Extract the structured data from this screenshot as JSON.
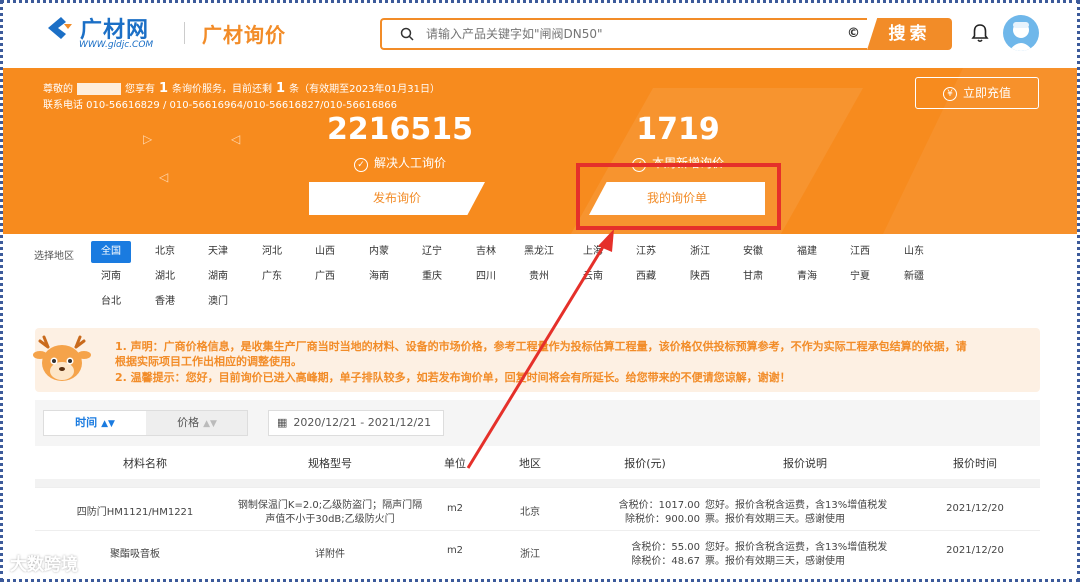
{
  "header": {
    "logo_text": "广材网",
    "logo_sub": "WWW.gldjc.COM",
    "brand_title": "广材询价",
    "search_placeholder": "请输入产品关键字如\"闸阀DN50\"",
    "clear_label": "©",
    "search_button": "搜索"
  },
  "banner": {
    "greet_prefix": "尊敬的",
    "greet_mid1": "您享有",
    "service_count": "1",
    "greet_mid2": "条询价服务，目前还剩",
    "remaining_count": "1",
    "greet_suffix": "条（有效期至2023年01月31日）",
    "phone_label": "联系电话 010-56616829 / 010-56616964/010-56616827/010-56616866",
    "recharge_icon": "¥",
    "recharge_label": "立即充值",
    "stat1_value": "2216515",
    "stat1_label": "解决人工询价",
    "stat2_value": "1719",
    "stat2_label": "本周新增询价",
    "publish_button": "发布询价",
    "my_list_button": "我的询价单"
  },
  "regions": {
    "label": "选择地区",
    "row1": [
      "全国",
      "北京",
      "天津",
      "河北",
      "山西",
      "内蒙",
      "辽宁",
      "吉林",
      "黑龙江",
      "上海",
      "江苏",
      "浙江",
      "安徽",
      "福建",
      "江西",
      "山东"
    ],
    "row2": [
      "河南",
      "湖北",
      "湖南",
      "广东",
      "广西",
      "海南",
      "重庆",
      "四川",
      "贵州",
      "云南",
      "西藏",
      "陕西",
      "甘肃",
      "青海",
      "宁夏",
      "新疆"
    ],
    "row3": [
      "台北",
      "香港",
      "澳门"
    ],
    "active": "全国"
  },
  "notice": {
    "line1": "1. 声明：广商价格信息，是收集生产厂商当时当地的材料、设备的市场价格，参考工程量作为投标估算工程量，该价格仅供投标预算参考，不作为实际工程承包结算的依据，请",
    "line2": "根据实际项目工作出相应的调整使用。",
    "line3": "2. 温馨提示：您好，目前询价已进入高峰期，单子排队较多，如若发布询价单，回复时间将会有所延长。给您带来的不便请您谅解，谢谢！"
  },
  "toolbar": {
    "sort_time": "时间",
    "sort_price": "价格",
    "date_range": "2020/12/21  -  2021/12/21"
  },
  "table": {
    "headers": [
      "材料名称",
      "规格型号",
      "单位",
      "地区",
      "报价(元)",
      "报价说明",
      "报价时间"
    ],
    "rows": [
      {
        "name": "四防门HM1121/HM1221",
        "spec1": "钢制保温门K=2.0;乙级防盗门；隔声门隔",
        "spec2": "声值不小于30dB;乙级防火门",
        "unit": "m2",
        "region": "北京",
        "price1": "含税价：1017.00",
        "price2": "除税价：900.00",
        "desc1": "您好。报价含税含运费，含13%增值税发",
        "desc2": "票。报价有效期三天。感谢使用",
        "date": "2021/12/20"
      },
      {
        "name": "聚酯吸音板",
        "spec1": "详附件",
        "spec2": "",
        "unit": "m2",
        "region": "浙江",
        "price1": "含税价：55.00",
        "price2": "除税价：48.67",
        "desc1": "您好。报价含税含运费，含13%增值税发",
        "desc2": "票。报价有效期三天，感谢使用",
        "date": "2021/12/20"
      }
    ]
  },
  "watermark": "大数跨境",
  "colors": {
    "brand_orange": "#f78b1e",
    "brand_blue": "#1a7be0",
    "highlight_red": "#e5302a"
  }
}
